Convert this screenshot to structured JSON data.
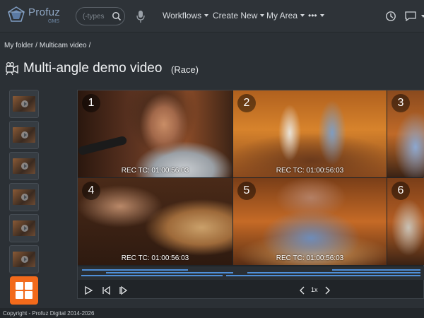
{
  "header": {
    "logo": {
      "name": "Profuz",
      "sub": "GMS"
    },
    "search": {
      "placeholder": "(-types"
    },
    "nav": [
      {
        "label": "Workflows"
      },
      {
        "label": "Create New"
      },
      {
        "label": "My Area"
      },
      {
        "label": "•••"
      }
    ]
  },
  "breadcrumb": [
    "My folder",
    "Multicam video"
  ],
  "breadcrumb_sep": "/",
  "title": {
    "main": "Multi-angle demo video",
    "sub": "(Race)"
  },
  "thumbnails": [
    {
      "name": "thumb-1"
    },
    {
      "name": "thumb-2"
    },
    {
      "name": "thumb-3"
    },
    {
      "name": "thumb-4"
    },
    {
      "name": "thumb-5"
    },
    {
      "name": "thumb-6"
    }
  ],
  "player": {
    "angles": [
      {
        "number": "1",
        "tc": "REC TC: 01:00:56:03"
      },
      {
        "number": "2",
        "tc": "REC TC: 01:00:56:03"
      },
      {
        "number": "3",
        "tc": ""
      },
      {
        "number": "4",
        "tc": "REC TC: 01:00:56:03"
      },
      {
        "number": "5",
        "tc": "REC TC: 01:00:56:03"
      },
      {
        "number": "6",
        "tc": ""
      }
    ],
    "speed": "1x"
  },
  "footer": "Copyright - Profuz Digital 2014-2026",
  "colors": {
    "accent": "#f26a1b",
    "timeline": "#4f8fd8",
    "background": "#2b3035"
  }
}
